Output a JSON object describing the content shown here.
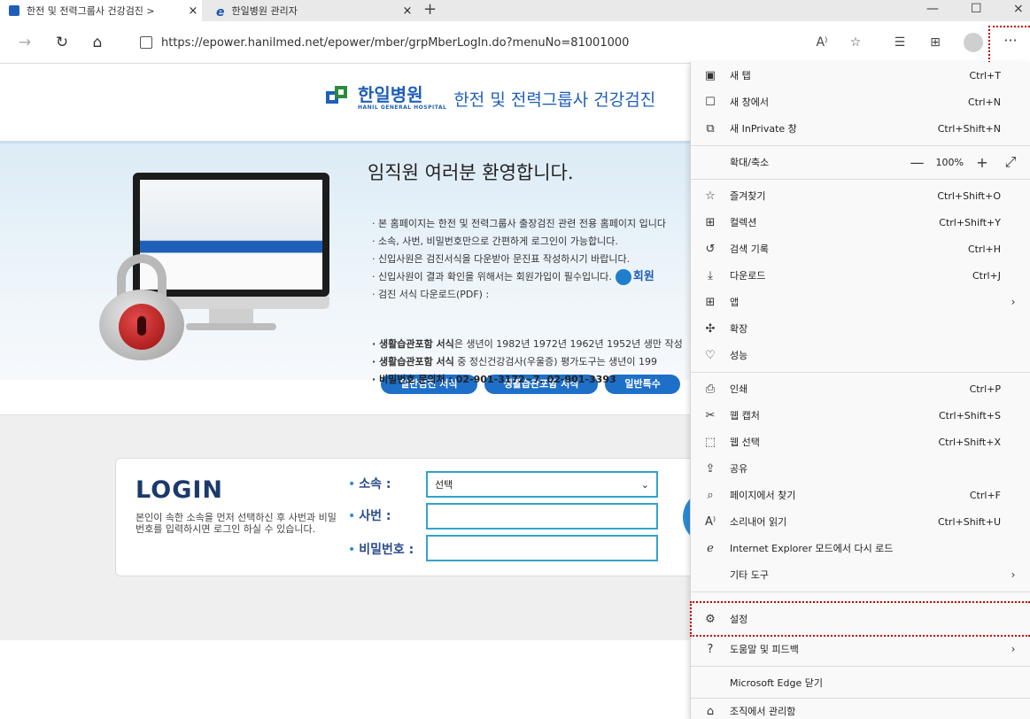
{
  "browser": {
    "tabs": [
      {
        "label": "한전 및 전력그룹사 건강검진 >",
        "close": "×"
      },
      {
        "label": "한일병원 관리자",
        "close": "×",
        "favicon": "e"
      }
    ],
    "new_tab": "+",
    "window_controls": {
      "minimize": "—",
      "maximize": "☐",
      "close": "×"
    },
    "url": "https://epower.hanilmed.net/epower/mber/grpMberLogIn.do?menuNo=81001000",
    "toolbar": {
      "read_aloud": "A⁾",
      "more": "···"
    }
  },
  "page": {
    "logo": {
      "korean": "한일병원",
      "english": "HANIL GENERAL HOSPITAL",
      "tagline": "한전 및 전력그룹사 건강검진"
    },
    "welcome": "임직원 여러분 환영합니다.",
    "bullets": [
      "· 본 홈페이지는 한전 및 전력그룹사 출장검진 관련 전용 홈페이지 입니다",
      "· 소속, 사번, 비밀번호만으로 간편하게 로그인이 가능합니다.",
      "· 신입사원은 검진서식을 다운받아 문진표 작성하시기 바랍니다.",
      "· 신입사원이 결과 확인을 위해서는 회원가입이 필수입니다.",
      "· 검진 서식 다운로드(PDF) :"
    ],
    "join_label": "회원",
    "download_buttons": [
      "일반검진 서식",
      "생활습관포함 서식",
      "일반특수"
    ],
    "notes": [
      {
        "bold": "· 생활습관포함 서식",
        "rest": "은 생년이 1982년 1972년 1962년 1952년 생만 작성"
      },
      {
        "bold": "· 생활습관포함 서식",
        "rest": " 중 정신건강검사(우울증) 평가도구는 생년이 199"
      },
      {
        "bold": "· 비밀번호 문의처 : 02-901-3172~7, 02-901-3393",
        "rest": ""
      }
    ],
    "login": {
      "title": "LOGIN",
      "description": "본인이 속한 소속을 먼저 선택하신 후 사번과 비밀번호를 입력하시면 로그인 하실 수 있습니다.",
      "fields": {
        "affiliation_label": "소속 :",
        "affiliation_value": "선택",
        "employee_id_label": "사번 :",
        "password_label": "비밀번호 :"
      }
    }
  },
  "menu": {
    "items": [
      {
        "icon": "new-tab-icon",
        "glyph": "▣",
        "label": "새 탭",
        "shortcut": "Ctrl+T"
      },
      {
        "icon": "new-window-icon",
        "glyph": "☐",
        "label": "새 창에서",
        "shortcut": "Ctrl+N"
      },
      {
        "icon": "inprivate-icon",
        "glyph": "⧉",
        "label": "새 InPrivate 창",
        "shortcut": "Ctrl+Shift+N"
      },
      {
        "icon": "",
        "glyph": "",
        "label": "확대/축소",
        "shortcut": ""
      },
      {
        "icon": "favorites-icon",
        "glyph": "☆",
        "label": "즐겨찾기",
        "shortcut": "Ctrl+Shift+O"
      },
      {
        "icon": "collections-icon",
        "glyph": "⊞",
        "label": "컬렉션",
        "shortcut": "Ctrl+Shift+Y"
      },
      {
        "icon": "history-icon",
        "glyph": "↺",
        "label": "검색 기록",
        "shortcut": "Ctrl+H"
      },
      {
        "icon": "download-icon",
        "glyph": "⤓",
        "label": "다운로드",
        "shortcut": "Ctrl+J"
      },
      {
        "icon": "apps-icon",
        "glyph": "⊞",
        "label": "앱",
        "shortcut": ""
      },
      {
        "icon": "extensions-icon",
        "glyph": "✣",
        "label": "확장",
        "shortcut": ""
      },
      {
        "icon": "performance-icon",
        "glyph": "♡",
        "label": "성능",
        "shortcut": ""
      },
      {
        "icon": "print-icon",
        "glyph": "⎙",
        "label": "인쇄",
        "shortcut": "Ctrl+P"
      },
      {
        "icon": "web-capture-icon",
        "glyph": "✂",
        "label": "웹 캡처",
        "shortcut": "Ctrl+Shift+S"
      },
      {
        "icon": "web-select-icon",
        "glyph": "⬚",
        "label": "웹 선택",
        "shortcut": "Ctrl+Shift+X"
      },
      {
        "icon": "share-icon",
        "glyph": "⇪",
        "label": "공유",
        "shortcut": ""
      },
      {
        "icon": "find-icon",
        "glyph": "⌕",
        "label": "페이지에서 찾기",
        "shortcut": "Ctrl+F"
      },
      {
        "icon": "read-aloud-icon",
        "glyph": "A⁾",
        "label": "소리내어 읽기",
        "shortcut": "Ctrl+Shift+U"
      },
      {
        "icon": "ie-mode-icon",
        "glyph": "ℯ",
        "label": "Internet Explorer 모드에서 다시 로드",
        "shortcut": ""
      },
      {
        "icon": "",
        "glyph": "",
        "label": "기타 도구",
        "shortcut": ""
      },
      {
        "icon": "settings-icon",
        "glyph": "⚙",
        "label": "설정",
        "shortcut": ""
      },
      {
        "icon": "help-icon",
        "glyph": "?",
        "label": "도움말 및 피드백",
        "shortcut": ""
      },
      {
        "icon": "",
        "glyph": "",
        "label": "Microsoft Edge 닫기",
        "shortcut": ""
      },
      {
        "icon": "managed-icon",
        "glyph": "⌂",
        "label": "조직에서 관리함",
        "shortcut": ""
      }
    ],
    "zoom": {
      "minus": "—",
      "value": "100%",
      "plus": "+",
      "fullscreen": "⤢"
    },
    "submenu_arrow": "›"
  }
}
